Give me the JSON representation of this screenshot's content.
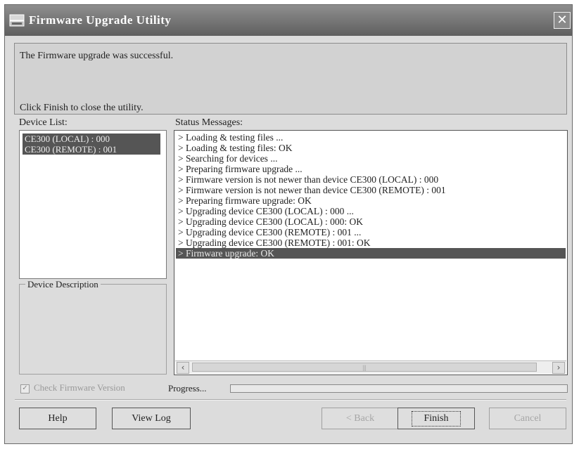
{
  "window": {
    "title": "Firmware Upgrade Utility",
    "close_glyph": "✕"
  },
  "message": {
    "line1": "The Firmware upgrade was successful.",
    "line2": "Click Finish to close the utility."
  },
  "device_list": {
    "label": "Device List:",
    "items": [
      "CE300 (LOCAL) : 000",
      "CE300 (REMOTE) : 001"
    ]
  },
  "device_description": {
    "label": "Device Description"
  },
  "status": {
    "label": "Status Messages:",
    "messages": [
      "> Loading & testing files ...",
      "> Loading & testing files: OK",
      "> Searching for devices ...",
      "> Preparing firmware upgrade ...",
      "> Firmware version is not newer than device CE300 (LOCAL) : 000",
      "> Firmware version is not newer than device CE300 (REMOTE) : 001",
      "> Preparing firmware upgrade: OK",
      "> Upgrading device CE300 (LOCAL) : 000 ...",
      "> Upgrading device CE300 (LOCAL) : 000: OK",
      "> Upgrading device CE300 (REMOTE) : 001 ...",
      "> Upgrading device CE300 (REMOTE) : 001: OK",
      "> Firmware upgrade: OK"
    ],
    "selected_index": 11
  },
  "options": {
    "check_firmware_label": "Check Firmware Version",
    "check_firmware_checked": true,
    "progress_label": "Progress..."
  },
  "buttons": {
    "help": "Help",
    "view_log": "View Log",
    "back": "< Back",
    "finish": "Finish",
    "cancel": "Cancel"
  }
}
